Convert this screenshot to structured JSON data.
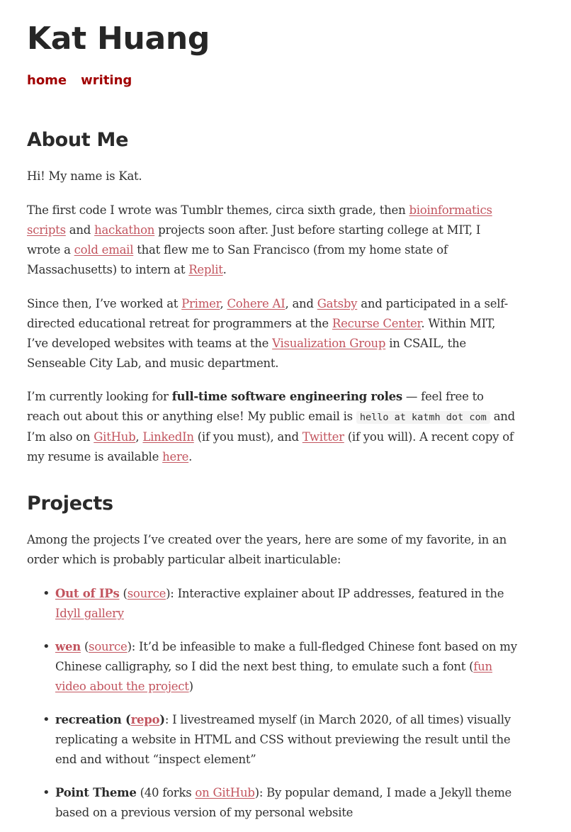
{
  "header": {
    "site_title": "Kat Huang",
    "nav": [
      {
        "label": "home"
      },
      {
        "label": "writing"
      }
    ]
  },
  "about": {
    "heading": "About Me",
    "p1": "Hi! My name is Kat.",
    "p2": {
      "t1": "The first code I wrote was Tumblr themes, circa sixth grade, then ",
      "link1": "bioinformatics scripts",
      "t2": " and ",
      "link2": "hackathon",
      "t3": " projects soon after. Just before starting college at MIT, I wrote a ",
      "link3": "cold email",
      "t4": " that flew me to San Francisco (from my home state of Massachusetts) to intern at ",
      "link4": "Replit",
      "t5": "."
    },
    "p3": {
      "t1": "Since then, I’ve worked at ",
      "link1": "Primer",
      "t2": ", ",
      "link2": "Cohere AI",
      "t3": ", and ",
      "link3": "Gatsby",
      "t4": " and participated in a self-directed educational retreat for programmers at the ",
      "link4": "Recurse Center",
      "t5": ". Within MIT, I’ve developed websites with teams at the ",
      "link5": "Visualization Group",
      "t6": " in CSAIL, the Senseable City Lab, and music department."
    },
    "p4": {
      "t1": "I’m currently looking for ",
      "bold": "full-time software engineering roles",
      "t2": " — feel free to reach out about this or anything else! My public email is ",
      "code": "hello at katmh dot com",
      "t3": " and I’m also on ",
      "link1": "GitHub",
      "t4": ", ",
      "link2": "LinkedIn",
      "t5": " (if you must), and ",
      "link3": "Twitter",
      "t6": " (if you will). A recent copy of my resume is available ",
      "link4": "here",
      "t7": "."
    }
  },
  "projects": {
    "heading": "Projects",
    "intro": "Among the projects I’ve created over the years, here are some of my favorite, in an order which is probably particular albeit inarticulable:",
    "bullet": "•",
    "items": [
      {
        "title": "Out of IPs",
        "pre": " (",
        "source": "source",
        "mid": "): Interactive explainer about IP addresses, featured in the ",
        "link": "Idyll gallery",
        "post": ""
      },
      {
        "title": "wen",
        "pre": " (",
        "source": "source",
        "mid": "): It’d be infeasible to make a full-fledged Chinese font based on my Chinese calligraphy, so I did the next best thing, to emulate such a font (",
        "link": "fun video about the project",
        "post": ")"
      },
      {
        "title_pre": "recreation (",
        "title_link": "repo",
        "title_post": ")",
        "desc": ": I livestreamed myself (in March 2020, of all times) visually replicating a website in HTML and CSS without previewing the result until the end and without “inspect element”"
      },
      {
        "title": "Point Theme",
        "pre": " (40 forks ",
        "link": "on GitHub",
        "desc": "): By popular demand, I made a Jekyll theme based on a previous version of my personal website"
      }
    ]
  },
  "colors": {
    "link": "#c2545e",
    "nav": "#a10000",
    "text": "#303030"
  }
}
